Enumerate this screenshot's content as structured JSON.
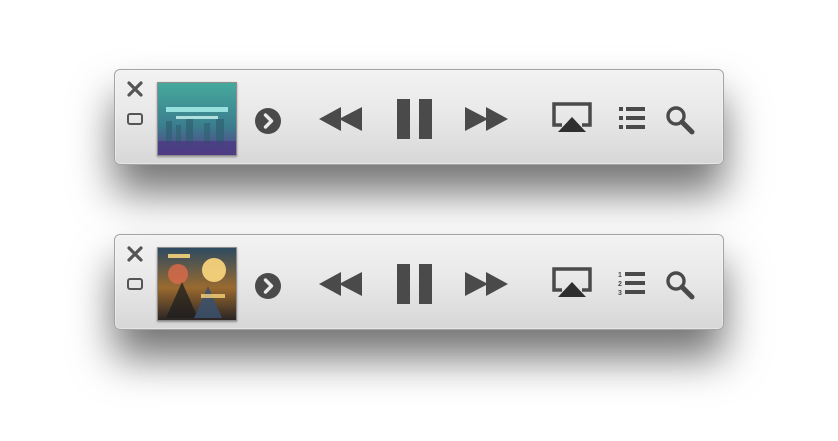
{
  "players": [
    {
      "artwork": {
        "palette": {
          "top": "#46a99d",
          "middle": "#3b7d8e",
          "bottom": "#5a3d89",
          "accent": "#a6f0ea"
        }
      },
      "playlist_style": "list-bullets-icon",
      "state": "playing"
    },
    {
      "artwork": {
        "palette": {
          "top": "#2d4a61",
          "middle": "#9a6a2f",
          "bottom": "#2a2525",
          "accent": "#f6d27b"
        }
      },
      "playlist_style": "list-numbered-icon",
      "playlist_numbers": [
        "1",
        "2",
        "3"
      ],
      "state": "playing"
    }
  ],
  "colors": {
    "icon": "#4a4a4a",
    "icon_dark": "#2f2f2f",
    "panel_top": "#f2f2f2",
    "panel_bottom": "#d7d7d7"
  }
}
